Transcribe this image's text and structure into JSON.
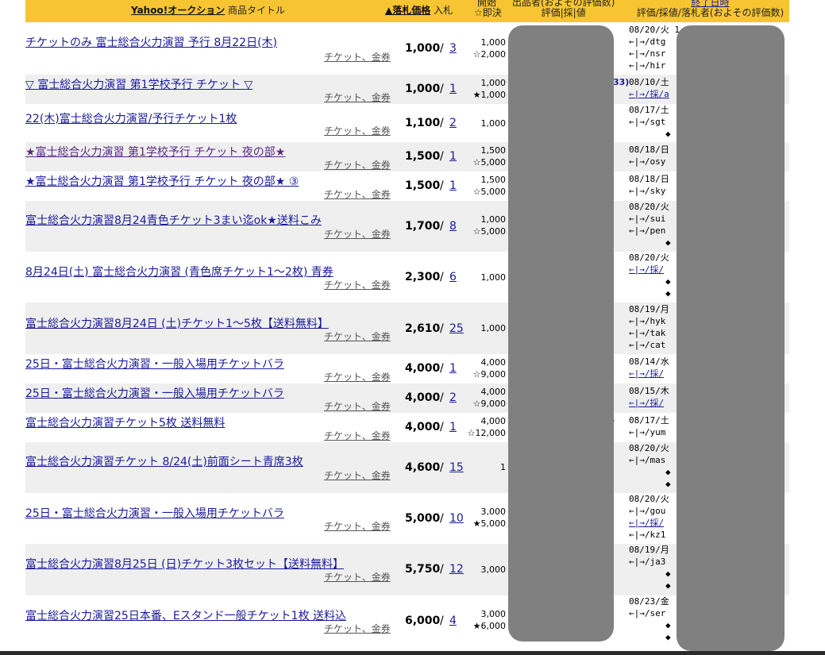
{
  "header": {
    "yahoo_link": "Yahoo!オークション",
    "title_col": "商品タイトル",
    "price_col": "▲落札価格",
    "bids_col": "入札",
    "start_col_1": "開始",
    "start_col_2": "☆即決",
    "seller_col_1": "出品者(およその評価数)",
    "seller_col_2": "評価|採|値",
    "end_col_1": "終了日時",
    "end_col_2": "評価/採値/落札者(およその評価数)"
  },
  "category": "チケット、金券",
  "rows": [
    {
      "title": "チケットのみ 富士総合火力演習 予行 8月22日(木)",
      "price": "1,000",
      "bids": "3",
      "start": "1,000",
      "sokketsu": "☆2,000",
      "end": [
        "08/20/火 1",
        "←|→/dtg",
        "←|→/nsr",
        "←|→/hir"
      ]
    },
    {
      "title": "▽ 富士総合火力演習 第1学校予行 チケット ▽",
      "price": "1,000",
      "bids": "1",
      "start": "1,000",
      "sokketsu": "★1,000",
      "end": [
        "08/10/土",
        "←|→/採/a"
      ]
    },
    {
      "title": "22(木)富士総合火力演習/予行チケット1枚",
      "price": "1,100",
      "bids": "2",
      "start": "1,000",
      "sokketsu": "",
      "end": [
        "08/17/土",
        "←|→/sgt",
        "◆"
      ]
    },
    {
      "title": "★富士総合火力演習 第1学校予行 チケット 夜の部★",
      "price": "1,500",
      "bids": "1",
      "start": "1,500",
      "sokketsu": "☆5,000",
      "end": [
        "08/18/日",
        "←|→/osy"
      ]
    },
    {
      "title": "★富士総合火力演習 第1学校予行 チケット 夜の部★ ③",
      "price": "1,500",
      "bids": "1",
      "start": "1,500",
      "sokketsu": "☆5,000",
      "end": [
        "08/18/日",
        "←|→/sky"
      ]
    },
    {
      "title": "富士総合火力演習8月24青色チケット3まい迄ok★送料こみ",
      "price": "1,700",
      "bids": "8",
      "start": "1,000",
      "sokketsu": "☆5,000",
      "end": [
        "08/20/火",
        "←|→/sui",
        "←|→/pen",
        "◆"
      ]
    },
    {
      "title": "8月24日(土) 富士総合火力演習 (青色席チケット1～2枚) 青券",
      "price": "2,300",
      "bids": "6",
      "start": "1,000",
      "sokketsu": "",
      "end": [
        "08/20/火",
        "←|→/採/",
        "◆",
        "◆"
      ]
    },
    {
      "title": "富士総合火力演習8月24日 (土)チケット1～5枚【送料無料】",
      "price": "2,610",
      "bids": "25",
      "start": "1,000",
      "sokketsu": "",
      "end": [
        "08/19/月",
        "←|→/hyk",
        "←|→/tak",
        "←|→/cat"
      ]
    },
    {
      "title": "25日・富士総合火力演習・一般入場用チケットバラ",
      "price": "4,000",
      "bids": "1",
      "start": "4,000",
      "sokketsu": "☆9,000",
      "end": [
        "08/14/水",
        "←|→/採/"
      ]
    },
    {
      "title": "25日・富士総合火力演習・一般入場用チケットバラ",
      "price": "4,000",
      "bids": "2",
      "start": "4,000",
      "sokketsu": "☆9,000",
      "end": [
        "08/15/木",
        "←|→/採/"
      ]
    },
    {
      "title": "富士総合火力演習チケット5枚 送料無料",
      "price": "4,000",
      "bids": "1",
      "start": "4,000",
      "sokketsu": "☆12,000",
      "end": [
        "08/17/土",
        "←|→/yum"
      ]
    },
    {
      "title": "富士総合火力演習チケット 8/24(土)前面シート青席3枚",
      "price": "4,600",
      "bids": "15",
      "start": "1",
      "sokketsu": "",
      "end": [
        "08/20/火",
        "←|→/mas",
        "◆",
        "◆"
      ]
    },
    {
      "title": "25日・富士総合火力演習・一般入場用チケットバラ",
      "price": "5,000",
      "bids": "10",
      "start": "3,000",
      "sokketsu": "★5,000",
      "end": [
        "08/20/火",
        "←|→/gou",
        "←|→/採/",
        "←|→/kz1"
      ]
    },
    {
      "title": "富士総合火力演習8月25日 (日)チケット3枚セット【送料無料】",
      "price": "5,750",
      "bids": "12",
      "start": "3,000",
      "sokketsu": "",
      "end": [
        "08/19/月",
        "←|→/ja3",
        "◆",
        "◆"
      ]
    },
    {
      "title": "富士総合火力演習25日本番、Eスタンド一般チケット1枚 送料込",
      "price": "6,000",
      "bids": "4",
      "start": "3,000",
      "sokketsu": "★6,000",
      "end": [
        "08/23/金",
        "←|→/ser",
        "◆",
        "◆"
      ]
    }
  ],
  "fragments": {
    "seller_rating_fragment": "33)",
    "row11_fragment": ")"
  }
}
